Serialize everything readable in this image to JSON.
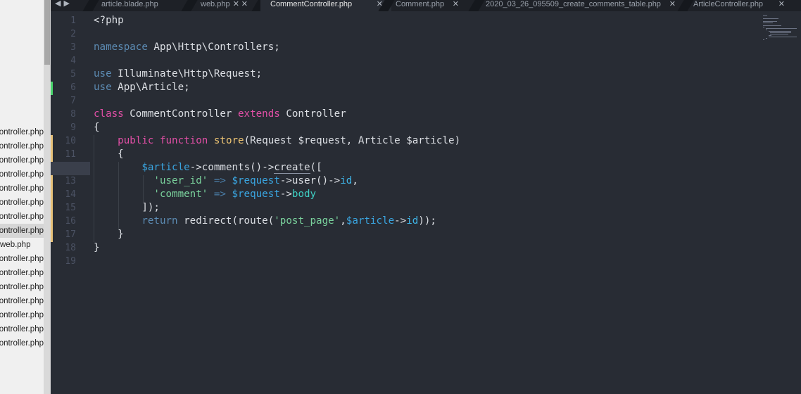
{
  "sidebar": {
    "files": [
      {
        "label": "ForgotPasswordController.php",
        "selected": false
      },
      {
        "label": "ResetPasswordController.php",
        "selected": false
      },
      {
        "label": "ArticleController.php",
        "selected": false
      },
      {
        "label": "HomeController.php",
        "selected": false
      },
      {
        "label": "ConfirmPasswordController.php",
        "selected": false
      },
      {
        "label": "VerificationController.php",
        "selected": false
      },
      {
        "label": "LoginController.php",
        "selected": false
      },
      {
        "label": "CommentController.php",
        "selected": true
      },
      {
        "label": "web.php",
        "selected": false
      },
      {
        "label": "PostController.php",
        "selected": false
      },
      {
        "label": "UserController.php",
        "selected": false
      },
      {
        "label": "TagController.php",
        "selected": false
      },
      {
        "label": "CategoryController.php",
        "selected": false
      },
      {
        "label": "Controller.php",
        "selected": false
      },
      {
        "label": "RegistrationController.php",
        "selected": false
      },
      {
        "label": "AdminController.php",
        "selected": false
      }
    ]
  },
  "tabs": [
    {
      "label": "article.blade.php",
      "active": false
    },
    {
      "label": "web.php",
      "active": false
    },
    {
      "label": "CommentController.php",
      "active": true
    },
    {
      "label": "Comment.php",
      "active": false
    },
    {
      "label": "2020_03_26_095509_create_comments_table.php",
      "active": false
    },
    {
      "label": "ArticleController.php",
      "active": false
    }
  ],
  "nav": {
    "back": "◀",
    "forward": "▶"
  },
  "close_glyph": "✕",
  "colors": {
    "editor_bg": "#282c34",
    "keyword": "#5c8bb3",
    "magenta_keyword": "#e14fa6",
    "function": "#f0c674",
    "variable": "#3aa5e0",
    "string": "#7ad19c",
    "modified_marker": "#e8c27a",
    "added_marker": "#4ad66d"
  },
  "code": {
    "l1": "<?php",
    "l3_kw": "namespace",
    "l3_rest": " App\\Http\\Controllers;",
    "l5_kw": "use",
    "l5_rest": " Illuminate\\Http\\Request;",
    "l6_kw": "use",
    "l6_rest": " App\\Article;",
    "l8_kw": "class",
    "l8_name": " CommentController ",
    "l8_ext": "extends",
    "l8_parent": " Controller",
    "l9": "{",
    "l10_pub": "public",
    "l10_fn": "function",
    "l10_name": "store",
    "l10_a": "(Request ",
    "l10_v1": "$request",
    "l10_b": ", Article ",
    "l10_v2": "$article",
    "l10_c": ")",
    "l11": "{",
    "l12_v": "$article",
    "l12_a": "->",
    "l12_b": "comments()->",
    "l12_c": "create",
    "l12_d": "([",
    "l13_s": "'user_id'",
    "l13_op": " => ",
    "l13_v": "$request",
    "l13_a": "->user()->",
    "l13_p": "id",
    "l13_e": ",",
    "l14_s": "'comment'",
    "l14_op": " => ",
    "l14_v": "$request",
    "l14_a": "->",
    "l14_p": "body",
    "l15": "]);",
    "l16_kw": "return",
    "l16_a": " redirect(route(",
    "l16_s": "'post_page'",
    "l16_b": ",",
    "l16_v": "$article",
    "l16_c": "->",
    "l16_p": "id",
    "l16_d": "));",
    "l17": "}",
    "l18": "}"
  },
  "line_numbers": [
    "1",
    "2",
    "3",
    "4",
    "5",
    "6",
    "7",
    "8",
    "9",
    "10",
    "11",
    "",
    "13",
    "14",
    "15",
    "16",
    "17",
    "18",
    "19"
  ]
}
